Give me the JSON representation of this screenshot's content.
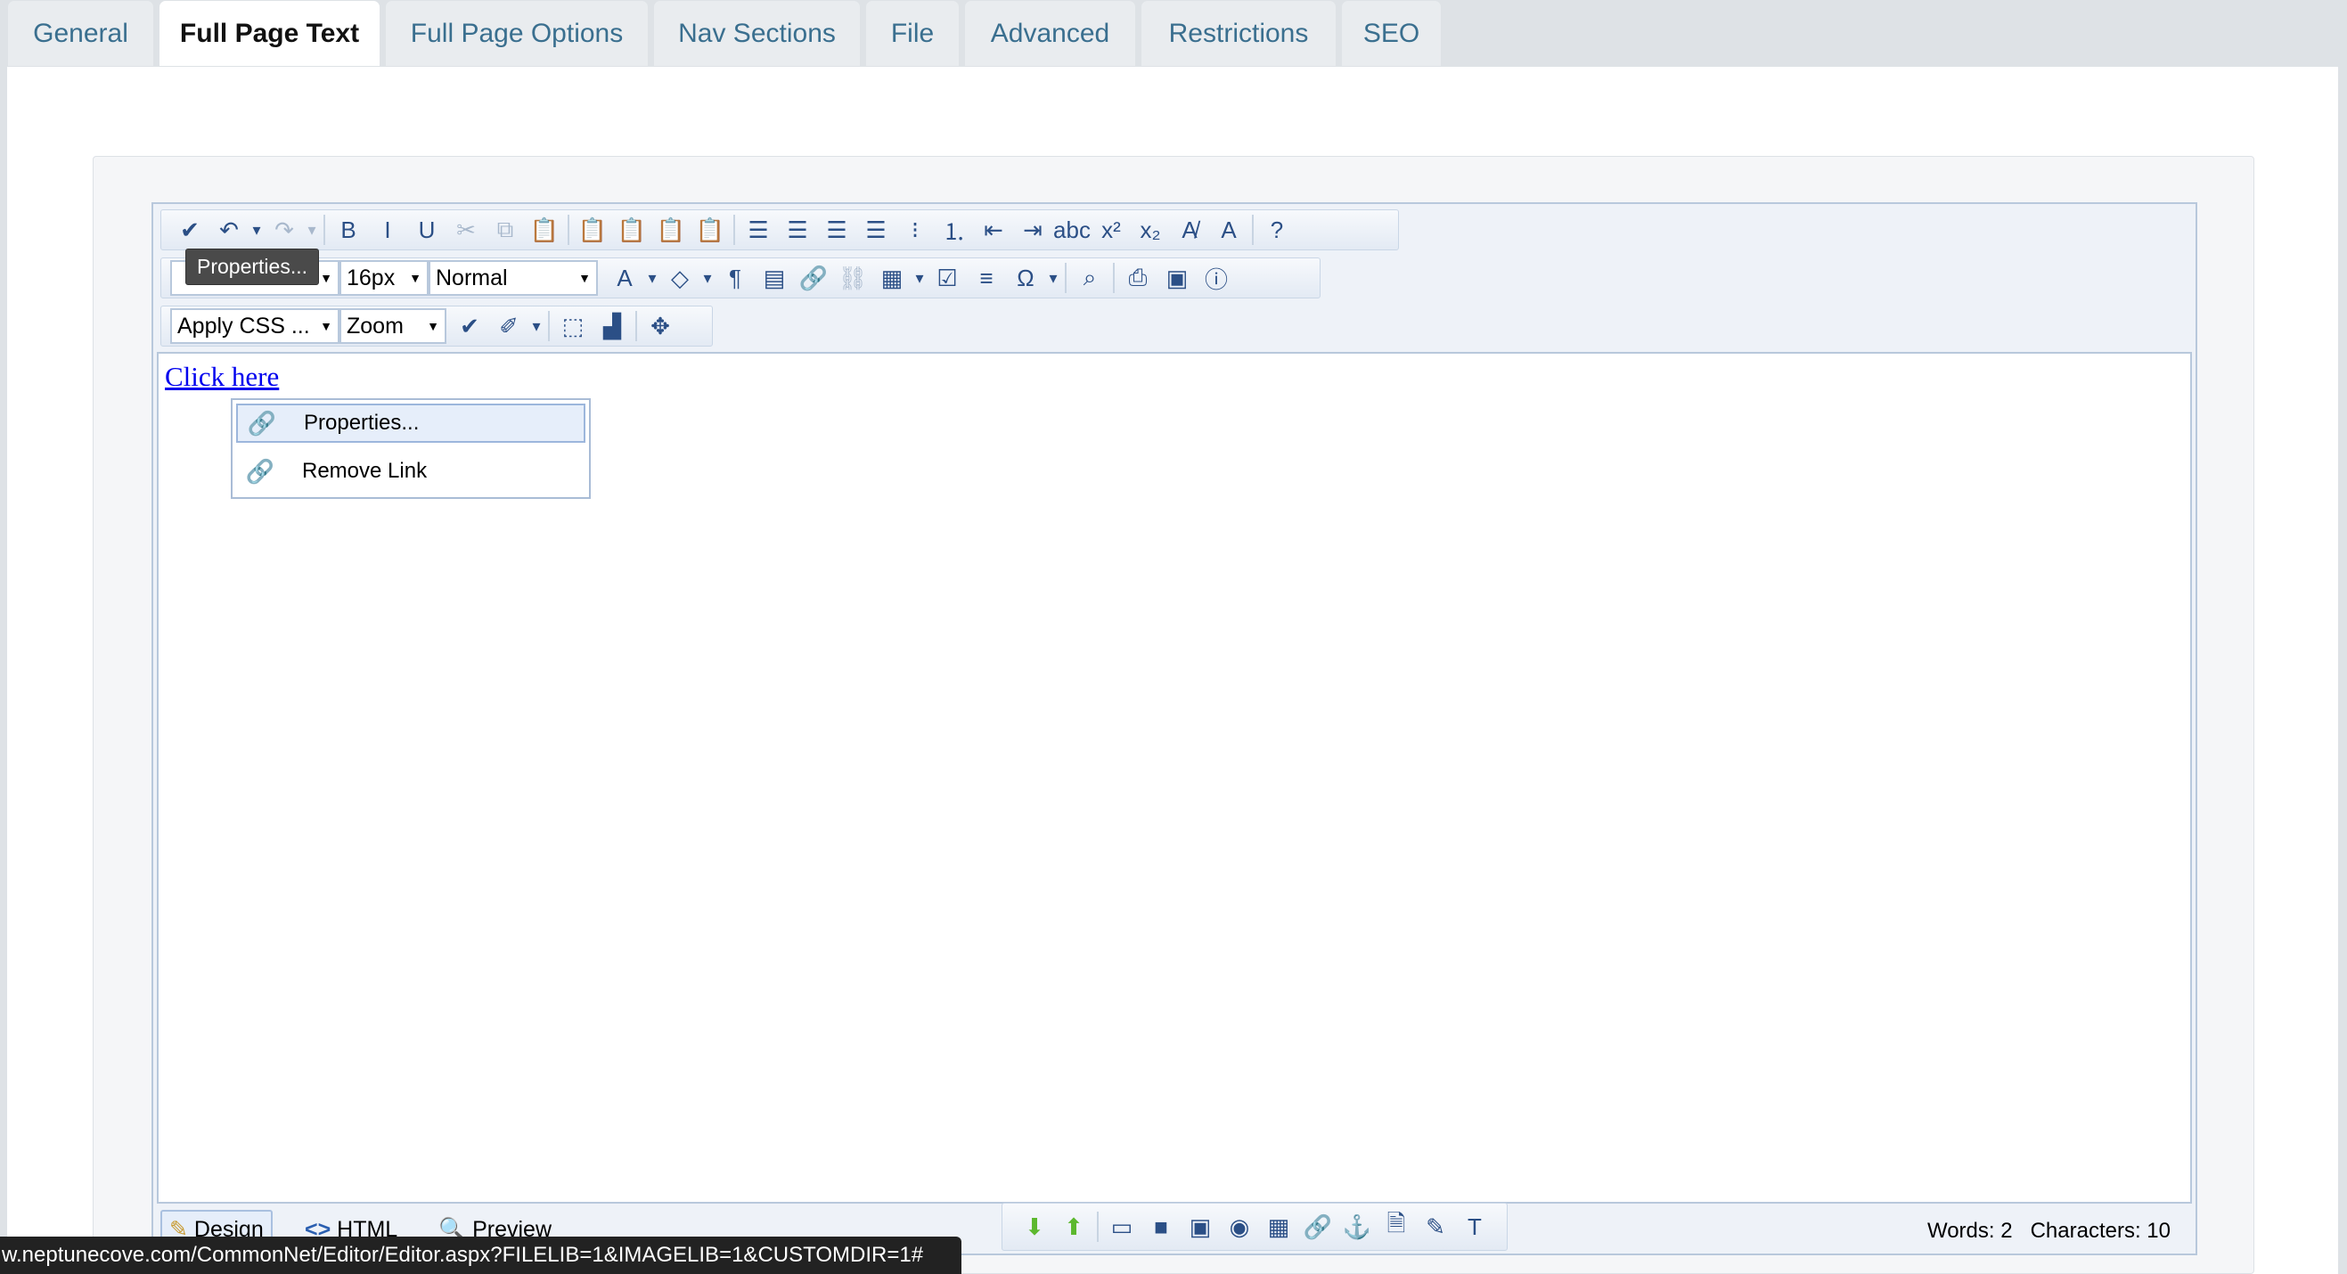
{
  "tabs": [
    {
      "label": "General"
    },
    {
      "label": "Full Page Text",
      "active": true
    },
    {
      "label": "Full Page Options"
    },
    {
      "label": "Nav Sections"
    },
    {
      "label": "File"
    },
    {
      "label": "Advanced"
    },
    {
      "label": "Restrictions"
    },
    {
      "label": "SEO"
    }
  ],
  "toolbar": {
    "row1": [
      "spellcheck-icon",
      "undo-icon",
      "dropdown-arrow",
      "redo-icon",
      "dropdown-arrow",
      "|",
      "bold-icon",
      "italic-icon",
      "underline-icon",
      "cut-icon",
      "copy-icon",
      "paste-icon",
      "|",
      "paste-word-icon",
      "paste-word-clean-icon",
      "paste-text-icon",
      "paste-html-icon",
      "|",
      "justify-full-icon",
      "align-left-icon",
      "align-center-icon",
      "align-right-icon",
      "bullet-list-icon",
      "numbered-list-icon",
      "outdent-icon",
      "indent-icon",
      "strikethrough-icon",
      "superscript-icon",
      "subscript-icon",
      "remove-format-icon",
      "clear-style-icon",
      "|",
      "help-icon"
    ],
    "font_size": "16px",
    "paragraph": "Normal",
    "row2": [
      "font-color-icon",
      "dropdown-arrow",
      "highlight-icon",
      "dropdown-arrow",
      "paragraph-icon",
      "page-properties-icon",
      "insert-link-icon",
      "unlink-icon",
      "table-icon",
      "dropdown-arrow",
      "form-icon",
      "horizontal-rule-icon",
      "special-char-icon",
      "dropdown-arrow",
      "|",
      "find-icon",
      "|",
      "print-icon",
      "preview-icon",
      "info-icon"
    ],
    "css": "Apply CSS ...",
    "zoom": "Zoom",
    "row3": [
      "w3c-validate-icon",
      "clean-icon",
      "dropdown-arrow",
      "|",
      "select-all-icon",
      "components-icon",
      "|",
      "absolute-position-icon"
    ]
  },
  "tooltip": "Properties...",
  "content": {
    "link_text": "Click here"
  },
  "context_menu": [
    {
      "label": "Properties...",
      "icon": "link-properties-icon"
    },
    {
      "label": "Remove Link",
      "icon": "remove-link-icon"
    }
  ],
  "modes": [
    {
      "label": "Design",
      "icon": "pencil-icon"
    },
    {
      "label": "HTML",
      "icon": "code-icon"
    },
    {
      "label": "Preview",
      "icon": "magnifier-icon"
    }
  ],
  "bottom_toolbar": [
    "move-down-icon",
    "move-up-icon",
    "|",
    "insert-box-icon",
    "insert-video-icon",
    "insert-flash-icon",
    "insert-media-icon",
    "insert-image-icon",
    "insert-link-icon",
    "insert-anchor-icon",
    "insert-document-icon",
    "edit-icon",
    "insert-template-icon"
  ],
  "status": {
    "words": "Words: 2",
    "characters": "Characters: 10"
  },
  "status_url": "w.neptunecove.com/CommonNet/Editor/Editor.aspx?FILELIB=1&IMAGELIB=1&CUSTOMDIR=1#"
}
